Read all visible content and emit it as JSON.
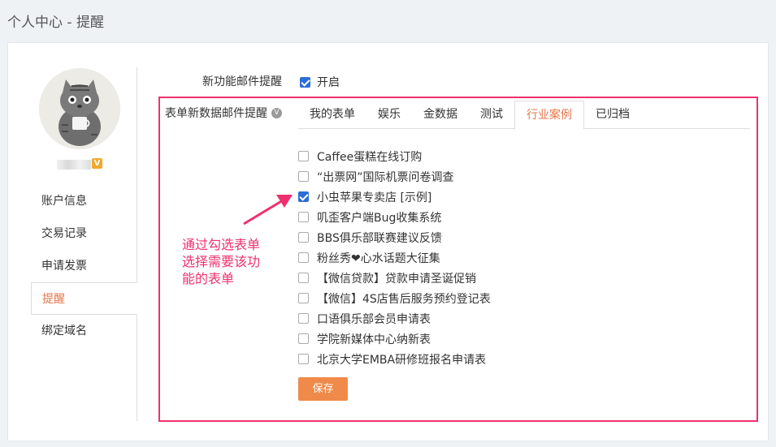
{
  "page": {
    "title": "个人中心 - 提醒"
  },
  "sidebar": {
    "badge": "V",
    "items": [
      {
        "label": "账户信息",
        "active": false
      },
      {
        "label": "交易记录",
        "active": false
      },
      {
        "label": "申请发票",
        "active": false
      },
      {
        "label": "提醒",
        "active": true
      },
      {
        "label": "绑定域名",
        "active": false
      }
    ]
  },
  "settings": {
    "new_feature_label": "新功能邮件提醒",
    "open_label": "开启",
    "open_checked": true,
    "form_data_label": "表单新数据邮件提醒",
    "info_icon": "V"
  },
  "tabs": [
    {
      "label": "我的表单",
      "active": false
    },
    {
      "label": "娱乐",
      "active": false
    },
    {
      "label": "金数据",
      "active": false
    },
    {
      "label": "测试",
      "active": false
    },
    {
      "label": "行业案例",
      "active": true
    },
    {
      "label": "已归档",
      "active": false
    }
  ],
  "forms": [
    {
      "label": "Caffee蛋糕在线订购",
      "checked": false
    },
    {
      "label": "“出票网”国际机票问卷调查",
      "checked": false
    },
    {
      "label": "小虫苹果专卖店 [示例]",
      "checked": true
    },
    {
      "label": "叽歪客户端Bug收集系统",
      "checked": false
    },
    {
      "label": "BBS俱乐部联赛建议反馈",
      "checked": false
    },
    {
      "label": "粉丝秀❤心水话题大征集",
      "checked": false
    },
    {
      "label": "【微信贷款】贷款申请圣诞促销",
      "checked": false
    },
    {
      "label": "【微信】4S店售后服务预约登记表",
      "checked": false
    },
    {
      "label": "口语俱乐部会员申请表",
      "checked": false
    },
    {
      "label": "学院新媒体中心纳新表",
      "checked": false
    },
    {
      "label": "北京大学EMBA研修班报名申请表",
      "checked": false
    }
  ],
  "save_label": "保存",
  "annotation": {
    "line1": "通过勾选表单",
    "line2": "选择需要该功",
    "line3": "能的表单"
  },
  "colors": {
    "accent": "#e8744a",
    "highlight": "#f0306e",
    "button": "#ef8a4a",
    "checkbox": "#2b6fd6"
  }
}
